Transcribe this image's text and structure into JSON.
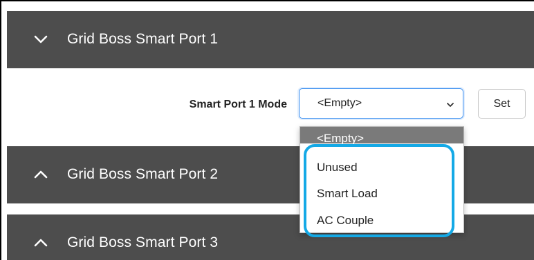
{
  "panels": [
    {
      "title": "Grid Boss Smart Port 1",
      "icon": "chevron-down-icon"
    },
    {
      "title": "Grid Boss Smart Port 2",
      "icon": "chevron-up-icon"
    },
    {
      "title": "Grid Boss Smart Port 3",
      "icon": "chevron-up-icon"
    }
  ],
  "port1": {
    "mode_label": "Smart Port 1 Mode",
    "mode_value": "<Empty>",
    "set_label": "Set"
  },
  "dropdown": {
    "options": [
      "<Empty>",
      "Unused",
      "Smart Load",
      "AC Couple"
    ],
    "selected_index": 0
  },
  "colors": {
    "header_bg": "#4d4d4d",
    "highlight": "#14a9e6",
    "select_focus": "#3b8ff0"
  }
}
